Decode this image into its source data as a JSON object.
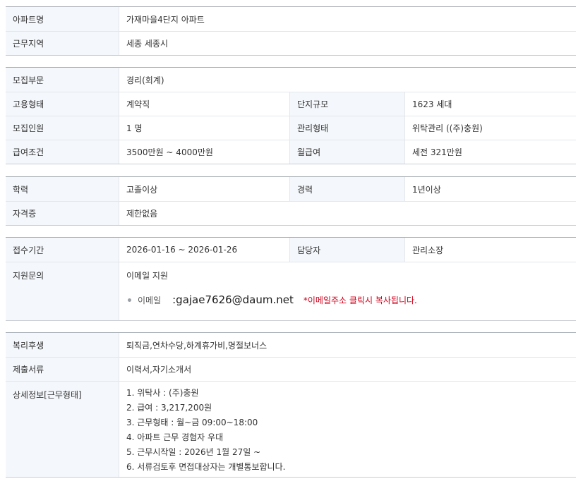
{
  "section1": {
    "apt_name_label": "아파트명",
    "apt_name_value": "가재마을4단지 아파트",
    "region_label": "근무지역",
    "region_value": "세종  세종시"
  },
  "section2": {
    "recruit_dept_label": "모집부문",
    "recruit_dept_value": "경리(회계)",
    "employ_type_label": "고용형태",
    "employ_type_value": "계약직",
    "complex_size_label": "단지규모",
    "complex_size_value": "1623 세대",
    "headcount_label": "모집인원",
    "headcount_value": "1 명",
    "mgmt_type_label": "관리형태",
    "mgmt_type_value": "위탁관리 ((주)충원)",
    "salary_label": "급여조건",
    "salary_value": "3500만원 ~ 4000만원",
    "monthly_label": "월급여",
    "monthly_value": "세전 321만원"
  },
  "section3": {
    "education_label": "학력",
    "education_value": "고졸이상",
    "career_label": "경력",
    "career_value": "1년이상",
    "license_label": "자격증",
    "license_value": "제한없음"
  },
  "section4": {
    "period_label": "접수기간",
    "period_value": "2026-01-16 ~ 2026-01-26",
    "manager_label": "담당자",
    "manager_value": "관리소장",
    "inquiry_label": "지원문의",
    "inquiry_value": "이메일 지원",
    "email_label": "이메일",
    "email_address": ":gajae7626@daum.net",
    "email_note": "*이메일주소 클릭시 복사됩니다."
  },
  "section5": {
    "benefits_label": "복리후생",
    "benefits_value": "퇴직금,연차수당,하계휴가비,명절보너스",
    "docs_label": "제출서류",
    "docs_value": "이력서,자기소개서",
    "detail_label": "상세정보[근무형태]",
    "detail_lines": [
      "1. 위탁사 : (주)충원",
      "2. 급여 : 3,217,200원",
      "3. 근무형태 : 월~금 09:00~18:00",
      "4. 아파트 근무 경험자 우대",
      "5. 근무시작일 : 2026년 1월 27일 ~",
      "6. 서류검토후 면접대상자는 개별통보합니다."
    ]
  },
  "colors": {
    "header_bg": "#f4f7fb",
    "border": "#e3e6ea",
    "note_red": "#d0021b"
  }
}
